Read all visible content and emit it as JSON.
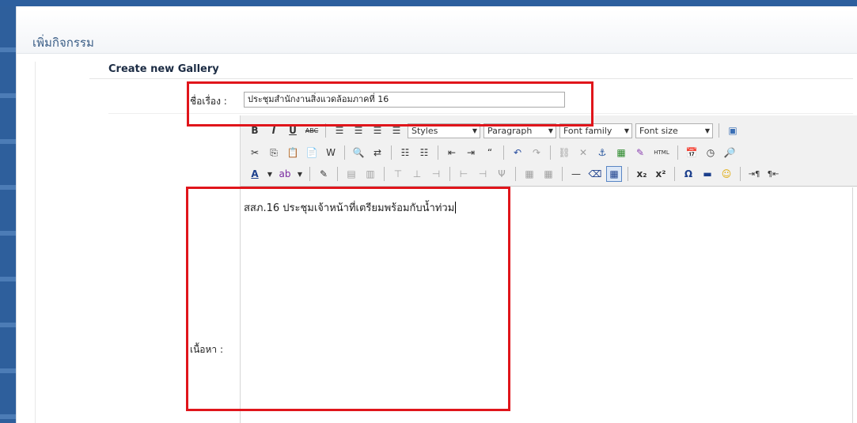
{
  "page": {
    "heading": "เพิ่มกิจกรรม",
    "form_title": "Create new Gallery"
  },
  "form": {
    "title_label": "ชื่อเรื่อง :",
    "title_value": "ประชุมสำนักงานสิ่งแวดล้อมภาคที่ 16",
    "content_label": "เนื้อหา :",
    "content_value": "สสภ.16 ประชุมเจ้าหน้าที่เตรียมพร้อมกับน้ำท่วม"
  },
  "toolbar": {
    "styles_label": "Styles",
    "paragraph_label": "Paragraph",
    "font_family_label": "Font family",
    "font_size_label": "Font size",
    "html_label": "HTML"
  },
  "colors": {
    "top_bar": "#2d5f9e",
    "highlight_box": "#e0151b",
    "heading_text": "#3a5d86"
  }
}
